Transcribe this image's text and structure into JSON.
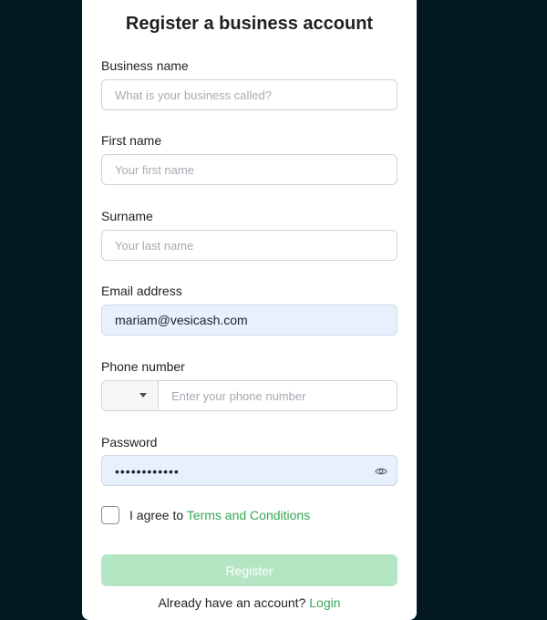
{
  "form": {
    "title": "Register a business account",
    "business_name": {
      "label": "Business name",
      "placeholder": "What is your business called?"
    },
    "first_name": {
      "label": "First name",
      "placeholder": "Your first name"
    },
    "surname": {
      "label": "Surname",
      "placeholder": "Your last name"
    },
    "email": {
      "label": "Email address",
      "value": "mariam@vesicash.com"
    },
    "phone": {
      "label": "Phone number",
      "placeholder": "Enter your phone number",
      "country_icon": "chevron-down-icon"
    },
    "password": {
      "label": "Password",
      "masked_value": "••••••••••••",
      "toggle_icon": "eye-icon"
    },
    "terms": {
      "prefix": "I agree to ",
      "link": "Terms and Conditions"
    },
    "register_label": "Register",
    "footer": {
      "prefix": "Already have an account? ",
      "link": "Login"
    }
  },
  "colors": {
    "background": "#021820",
    "accent": "#35a853",
    "button_disabled": "#b5e6c4",
    "autofill": "#e8f0fe"
  }
}
